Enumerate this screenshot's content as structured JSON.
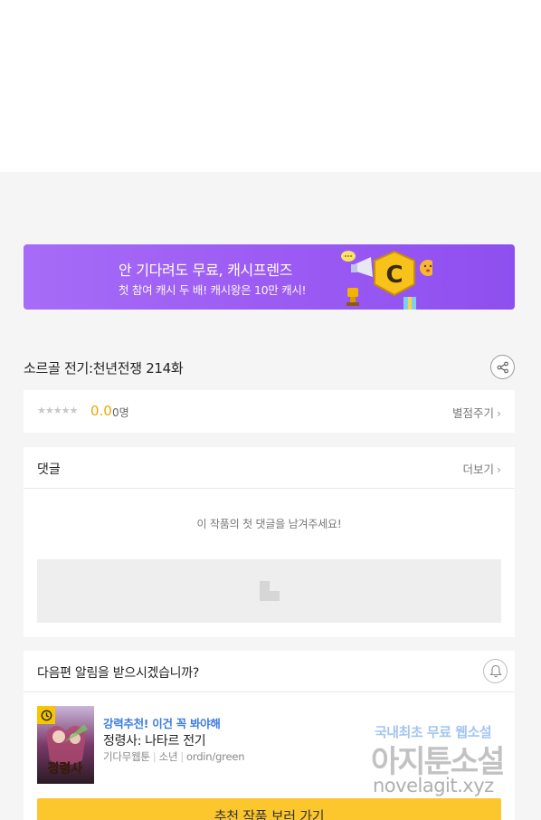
{
  "banner": {
    "title": "안 기다려도 무료, 캐시프렌즈",
    "subtitle": "첫 참여 캐시 두 배! 캐시왕은 10만 캐시!"
  },
  "episode": {
    "title": "소르골 전기:천년전쟁 214화"
  },
  "rating": {
    "stars": "★★★★★",
    "score": "0.0",
    "count": "0명",
    "rate_link": "별점주기",
    "chevron": "›"
  },
  "comments": {
    "title": "댓글",
    "more": "더보기",
    "empty_message": "이 작품의 첫 댓글을 남겨주세요!"
  },
  "notify": {
    "question": "다음편 알림을 받으시겠습니까?"
  },
  "recommendation": {
    "tag": "강력추천! 이건 꼭 봐야해",
    "title": "정령사: 나타르 전기",
    "meta": [
      "기다무웹툰",
      "소년",
      "ordin/green"
    ],
    "thumb_text": "정령사"
  },
  "cta": {
    "label": "추천 작품 보러 가기"
  },
  "watermark": {
    "line1": "국내최초 무료",
    "line1_highlight": "웹소설",
    "line2": "아지툰소설",
    "line3": "novelagit.xyz"
  },
  "colors": {
    "banner": "#9b5af3",
    "score": "#f0a500",
    "tag": "#3d7de0",
    "cta": "#fcc72d"
  },
  "icons": [
    "share-icon",
    "bell-icon",
    "clock-icon",
    "chevron-right-icon"
  ]
}
